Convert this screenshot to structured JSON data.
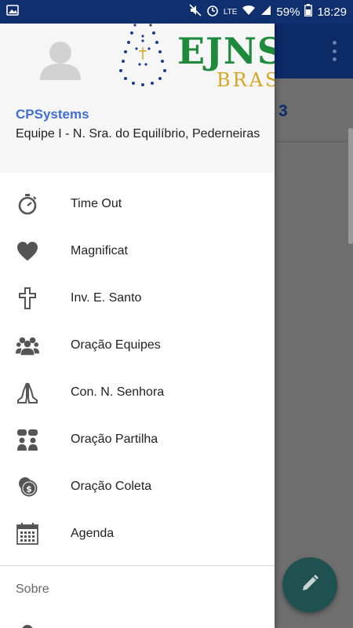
{
  "status_bar": {
    "battery": "59%",
    "time": "18:29",
    "network": "LTE"
  },
  "app": {
    "title_fragment": "3"
  },
  "drawer": {
    "header": {
      "logo_text": "EJNS",
      "logo_subtext": "BRASIL",
      "user_name": "CPSystems",
      "team": "Equipe I - N. Sra. do Equilíbrio, Pederneiras"
    },
    "items": [
      {
        "label": "Time Out",
        "icon": "stopwatch-icon"
      },
      {
        "label": "Magnificat",
        "icon": "heart-icon"
      },
      {
        "label": "Inv. E. Santo",
        "icon": "cross-icon"
      },
      {
        "label": "Oração Equipes",
        "icon": "group-icon"
      },
      {
        "label": "Con. N. Senhora",
        "icon": "praying-hands-icon"
      },
      {
        "label": "Oração Partilha",
        "icon": "chat-people-icon"
      },
      {
        "label": "Oração Coleta",
        "icon": "coins-icon"
      },
      {
        "label": "Agenda",
        "icon": "calendar-icon"
      }
    ],
    "section_label": "Sobre"
  },
  "colors": {
    "toolbar": "#0c2a66",
    "user_name": "#3f6fd1",
    "logo_green": "#1e8a3c",
    "logo_gold": "#d7a526",
    "fab": "#1f5150"
  }
}
